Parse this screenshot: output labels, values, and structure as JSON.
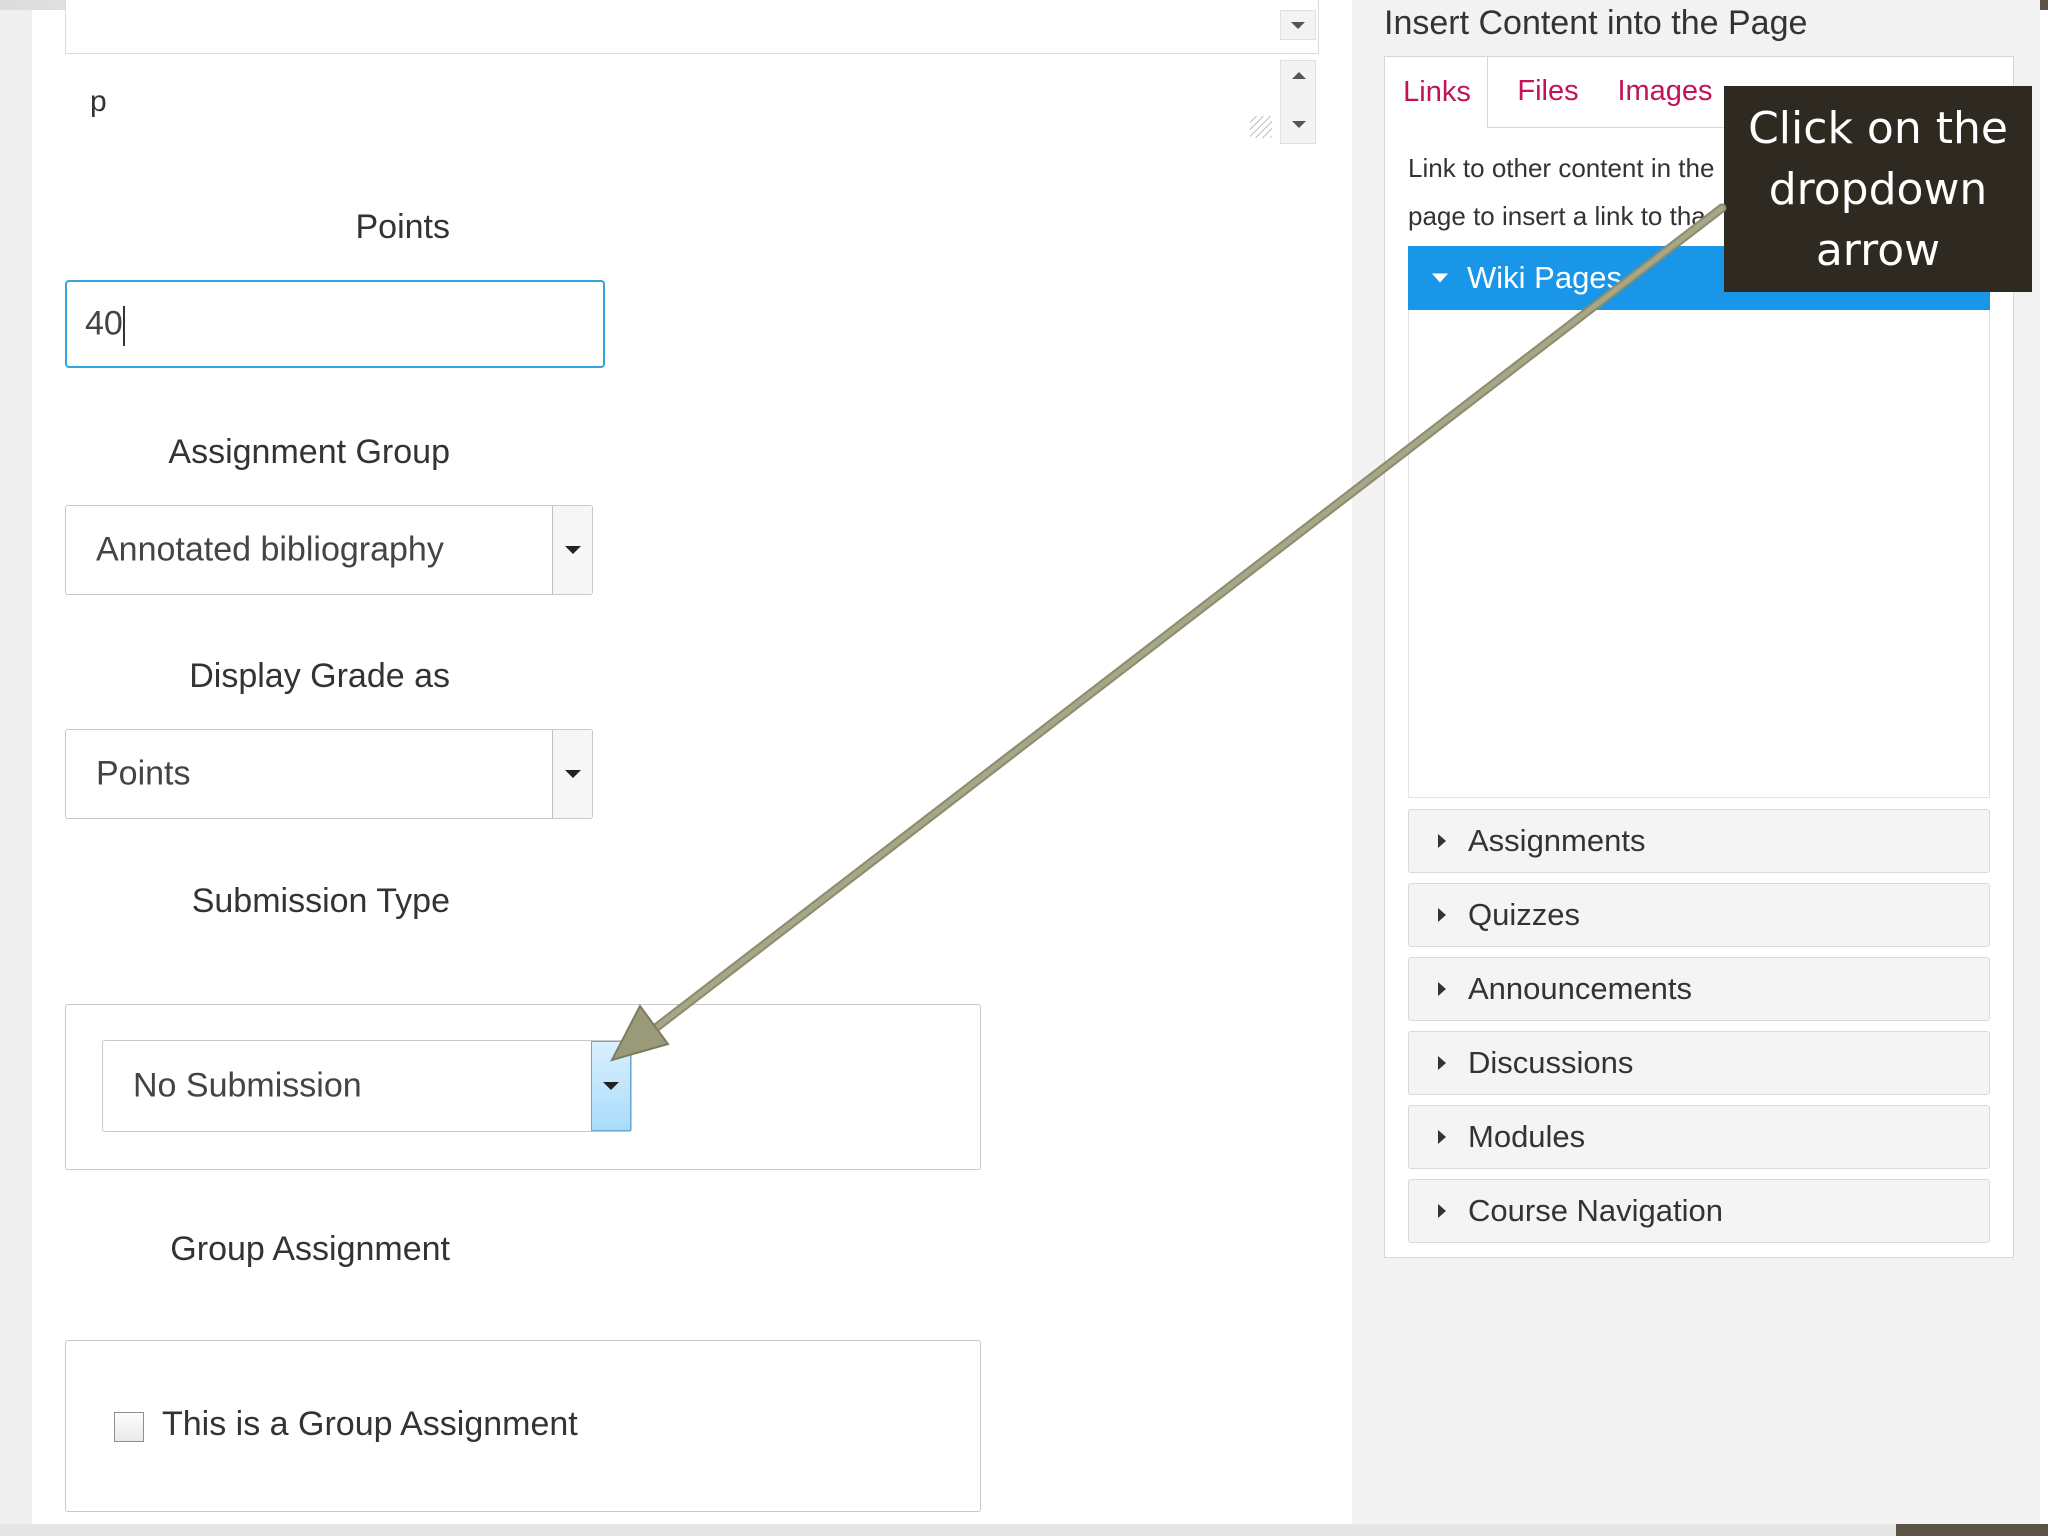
{
  "editor": {
    "path_tag": "p"
  },
  "form": {
    "points": {
      "label": "Points",
      "value": "40"
    },
    "assignment_group": {
      "label": "Assignment Group",
      "selected": "Annotated bibliography"
    },
    "display_grade": {
      "label": "Display Grade as",
      "selected": "Points"
    },
    "submission_type": {
      "label": "Submission Type",
      "selected": "No Submission"
    },
    "group_assignment": {
      "label": "Group Assignment",
      "checkbox_label": "This is a Group Assignment",
      "checked": false
    }
  },
  "sidebar": {
    "title": "Insert Content into the Page",
    "tabs": [
      {
        "label": "Links",
        "active": true
      },
      {
        "label": "Files",
        "active": false
      },
      {
        "label": "Images",
        "active": false
      }
    ],
    "description_lines": [
      "Link to other content in the",
      "page to insert a link to tha"
    ],
    "open_section": "Wiki Pages",
    "sections": [
      "Assignments",
      "Quizzes",
      "Announcements",
      "Discussions",
      "Modules",
      "Course Navigation"
    ]
  },
  "callout": {
    "lines": [
      "Click on the",
      "dropdown",
      "arrow"
    ]
  },
  "colors": {
    "accent_blue": "#1a96e8",
    "tab_text": "#c1125a",
    "callout_bg": "#2e2a22",
    "arrow": "#9a9a7a",
    "focus_border": "#33a6e0"
  }
}
